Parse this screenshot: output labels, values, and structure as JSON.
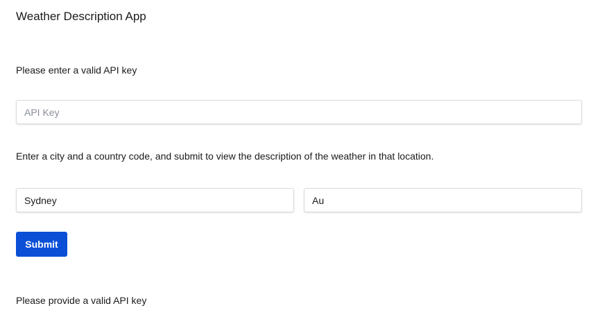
{
  "app": {
    "title": "Weather Description App"
  },
  "api_section": {
    "prompt": "Please enter a valid API key",
    "input_placeholder": "API Key",
    "input_value": ""
  },
  "location_section": {
    "prompt": "Enter a city and a country code, and submit to view the description of the weather in that location.",
    "city_value": "Sydney",
    "country_value": "Au"
  },
  "actions": {
    "submit_label": "Submit"
  },
  "status": {
    "message": "Please provide a valid API key"
  },
  "colors": {
    "primary_button": "#0a4fd6",
    "input_border": "#d9dbde"
  }
}
